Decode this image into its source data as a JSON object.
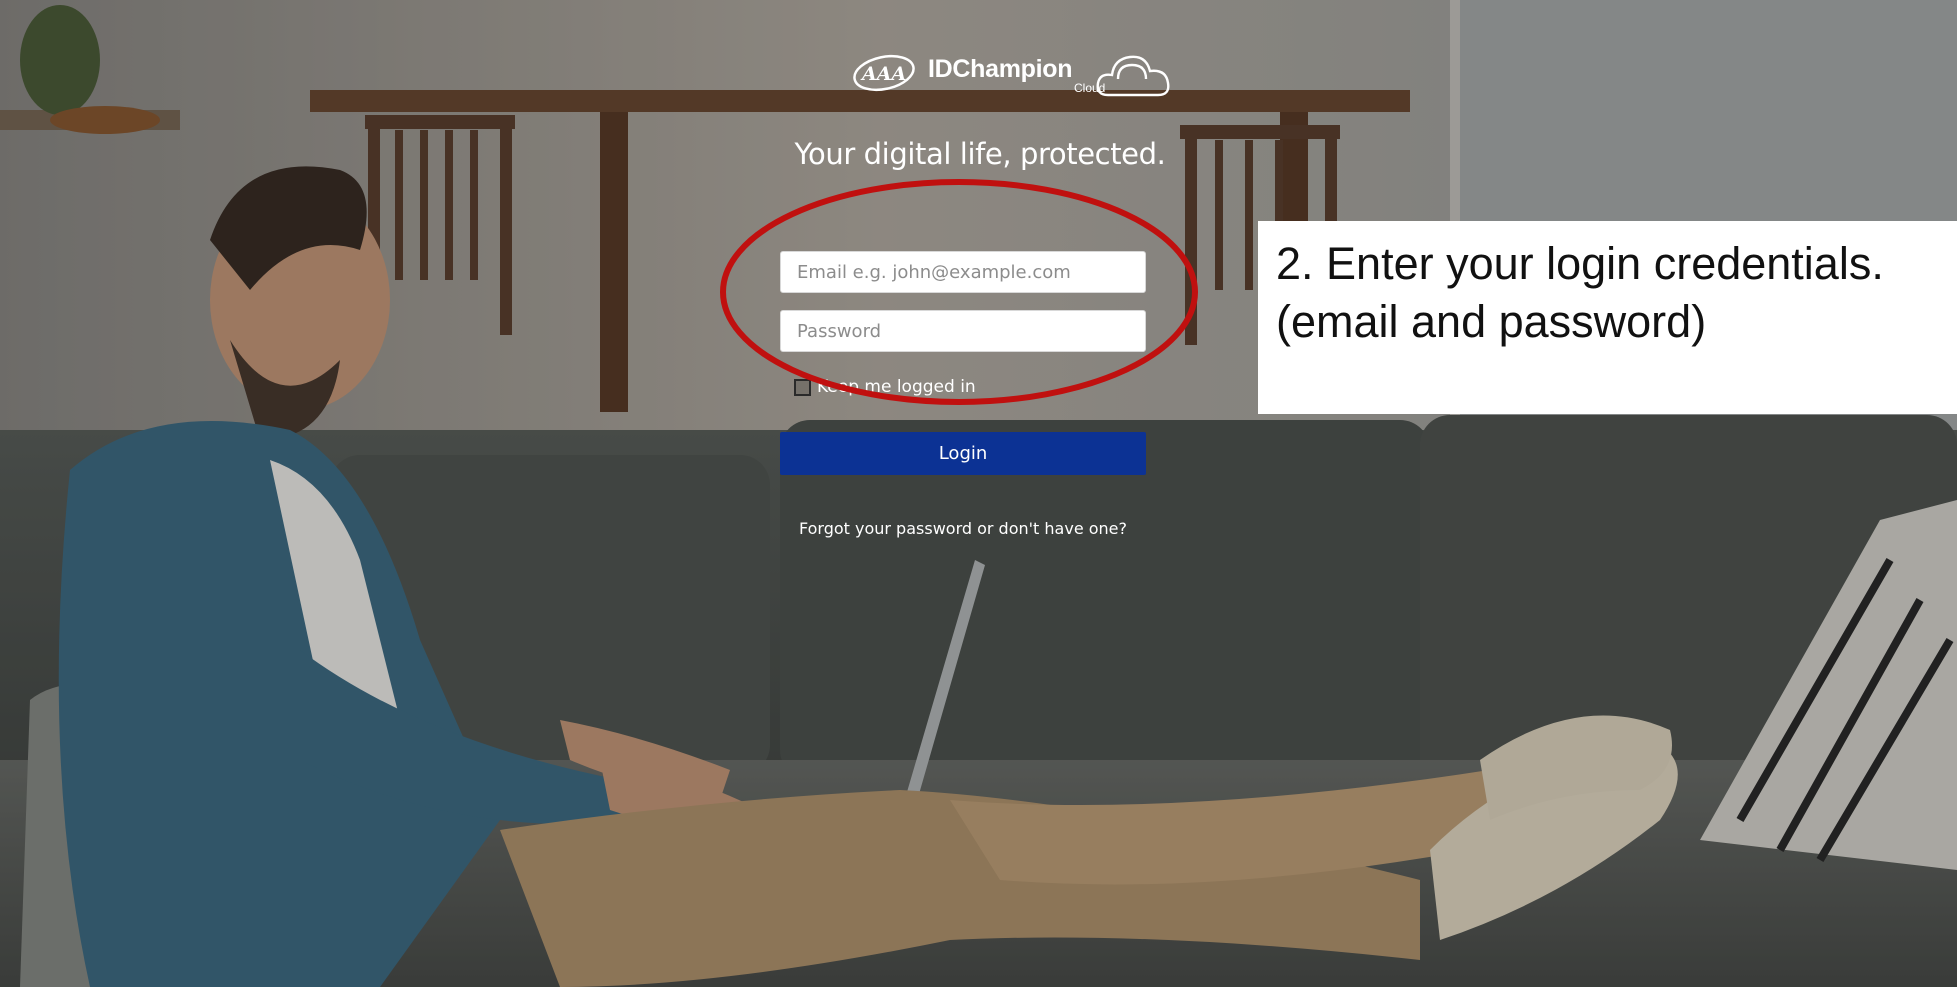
{
  "brand": {
    "logo_name": "IDChampion",
    "logo_suffix": "Cloud",
    "logo_mark": "AAA"
  },
  "login": {
    "tagline": "Your digital life, protected.",
    "email_placeholder": "Email e.g. john@example.com",
    "email_value": "",
    "password_placeholder": "Password",
    "password_value": "",
    "remember_label": "Keep me logged in",
    "remember_checked": false,
    "login_label": "Login",
    "forgot_link": "Forgot your password or don't have one?"
  },
  "annotation": {
    "instruction": "2. Enter your login credentials.\n(email and password)",
    "highlight_color": "#c0100f"
  },
  "colors": {
    "login_button": "#0c3294",
    "overlay_text": "#ffffff",
    "callout_background": "#ffffff"
  }
}
